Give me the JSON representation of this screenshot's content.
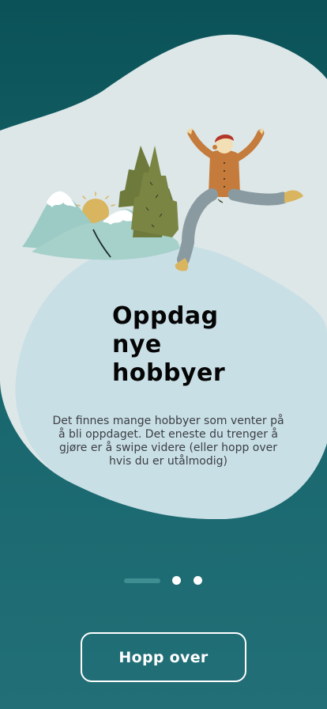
{
  "onboarding": {
    "title_lines": [
      "Oppdag",
      "nye",
      "hobbyer"
    ],
    "description": "Det finnes mange hobbyer som venter på å bli oppdaget. Det eneste du trenger å gjøre er å swipe videre (eller hopp over hvis du er utålmodig)",
    "skip_label": "Hopp over",
    "page_indicator": {
      "total": 3,
      "active_index": 0
    },
    "illustration": "person-jumping-mountains-illustration"
  },
  "colors": {
    "background_top": "#0a5257",
    "background_bottom": "#226f77",
    "blob_light": "#dde7e8",
    "blob_blue": "#c9dfe6",
    "text_dark": "#050505",
    "indicator_active": "#3e8e92",
    "button_border": "#ffffff"
  }
}
